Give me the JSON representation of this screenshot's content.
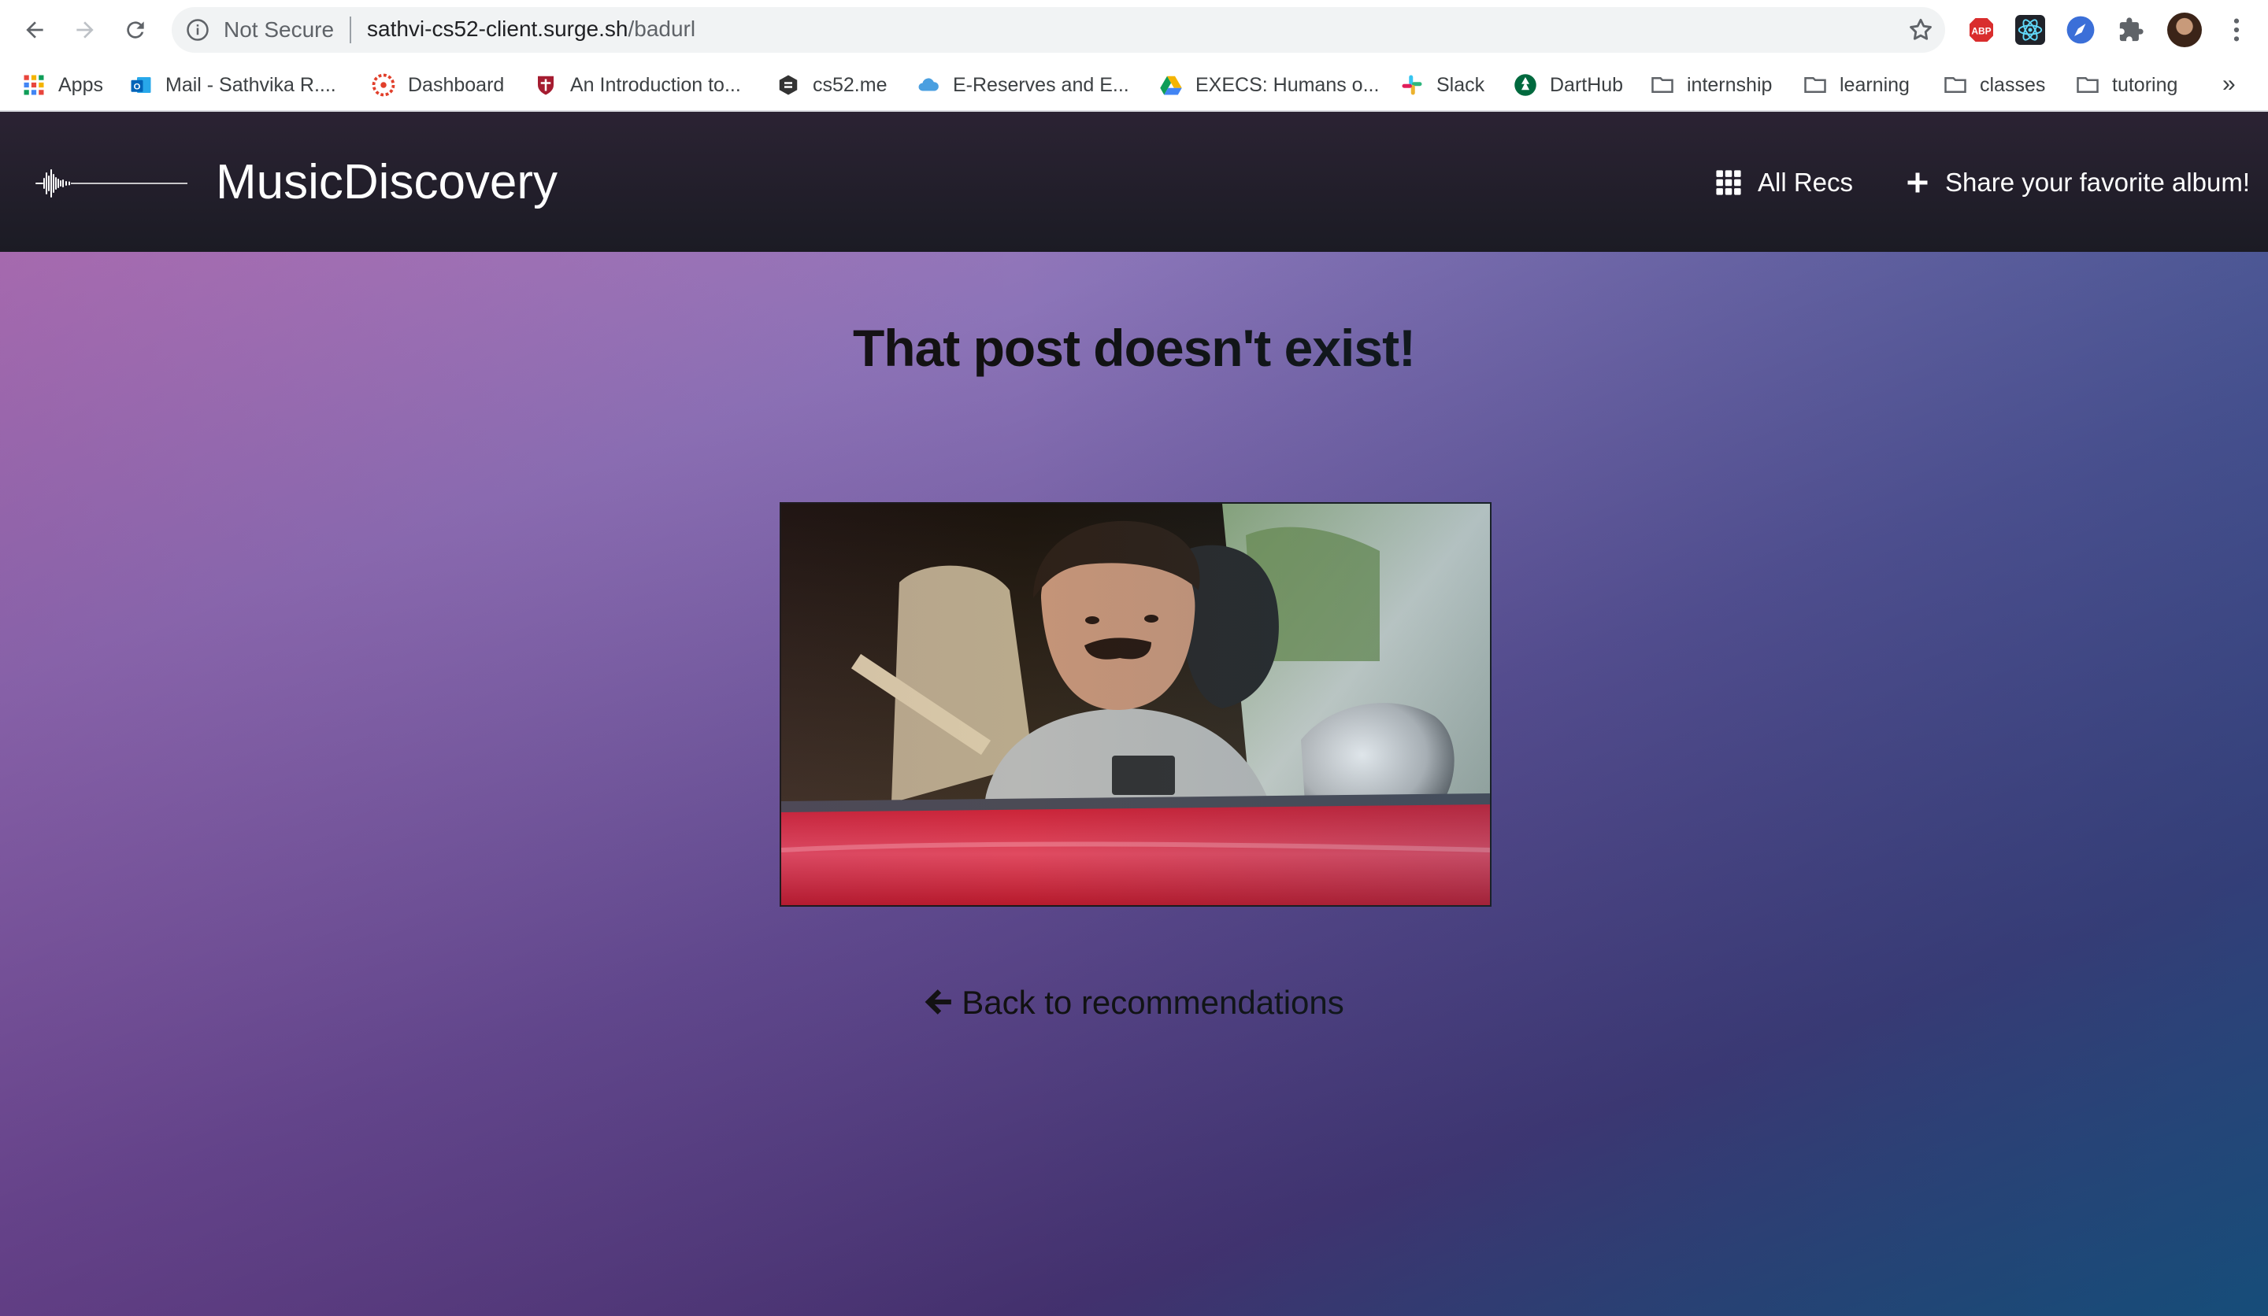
{
  "browser": {
    "security_label": "Not Secure",
    "url_host": "sathvi-cs52-client.surge.sh",
    "url_path": "/badurl",
    "bookmarks": [
      {
        "label": "Apps",
        "icon": "apps-grid-icon"
      },
      {
        "label": "Mail - Sathvika R....",
        "icon": "outlook-icon"
      },
      {
        "label": "Dashboard",
        "icon": "canvas-icon"
      },
      {
        "label": "An Introduction to...",
        "icon": "crest-icon"
      },
      {
        "label": "cs52.me",
        "icon": "cs52-icon"
      },
      {
        "label": "E-Reserves and E...",
        "icon": "cloud-icon"
      },
      {
        "label": "EXECS: Humans o...",
        "icon": "google-drive-icon"
      },
      {
        "label": "Slack",
        "icon": "slack-icon"
      },
      {
        "label": "DartHub",
        "icon": "darthub-icon"
      },
      {
        "label": "internship",
        "icon": "folder-icon"
      },
      {
        "label": "learning",
        "icon": "folder-icon"
      },
      {
        "label": "classes",
        "icon": "folder-icon"
      },
      {
        "label": "tutoring",
        "icon": "folder-icon"
      }
    ],
    "more_bookmarks": "»"
  },
  "app": {
    "brand": "MusicDiscovery",
    "nav": {
      "all_recs": "All Recs",
      "share": "Share your favorite album!"
    },
    "heading": "That post doesn't exist!",
    "back_link": "Back to recommendations"
  },
  "colors": {
    "nav_bg": "#1f1c27",
    "gradient_start": "#c283c3",
    "gradient_end": "#17466f"
  }
}
